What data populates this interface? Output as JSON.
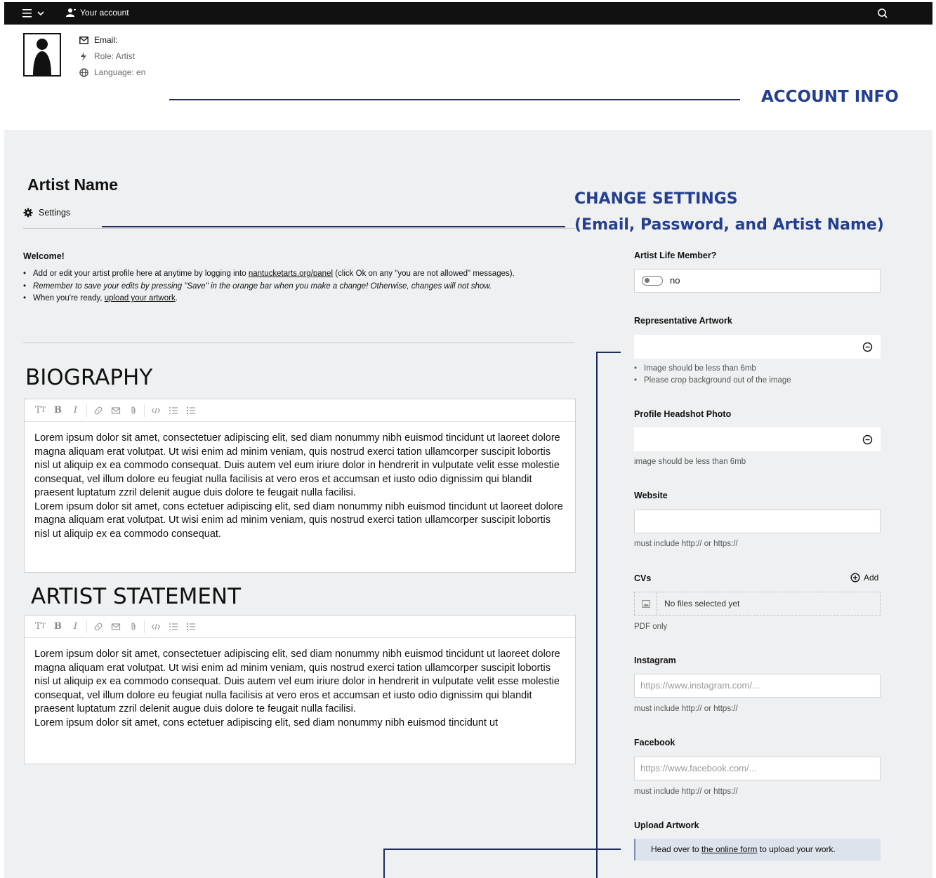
{
  "topbar": {
    "account_label": "Your account"
  },
  "account": {
    "email_label": "Email:",
    "role_label": "Role: Artist",
    "language_label": "Language: en"
  },
  "callouts": {
    "account_info": "ACCOUNT INFO",
    "change_settings_1": "CHANGE SETTINGS",
    "change_settings_2": "(Email, Password, and Artist Name)"
  },
  "profile": {
    "name": "Artist Name",
    "settings_tab": "Settings"
  },
  "welcome": {
    "heading": "Welcome!",
    "line1_pre": "Add or edit your artist profile here at anytime by logging into ",
    "line1_link": "nantucketarts.org/panel",
    "line1_post": " (click Ok on any \"you are not allowed\" messages).",
    "line2": "Remember to save your edits by pressing \"Save\" in the orange bar when you make a change! Otherwise, changes will not show.",
    "line3_pre": "When you're ready, ",
    "line3_link": "upload your artwork",
    "line3_post": "."
  },
  "biography": {
    "heading": "BIOGRAPHY",
    "p1": "Lorem ipsum dolor sit amet, consectetuer adipiscing elit, sed diam nonummy nibh euismod tincidunt ut laoreet dolore magna aliquam erat volutpat. Ut wisi enim ad minim veniam, quis nostrud exerci tation ullamcorper suscipit lobortis nisl ut aliquip ex ea commodo consequat. Duis autem vel eum iriure dolor in hendrerit in vulputate velit esse molestie consequat, vel illum dolore eu feugiat nulla facilisis at vero eros et accumsan et iusto odio dignissim qui blandit praesent luptatum zzril delenit augue duis dolore te feugait nulla facilisi.",
    "p2": "Lorem ipsum dolor sit amet, cons ectetuer adipiscing elit, sed diam nonummy nibh euismod tincidunt ut laoreet dolore magna aliquam erat volutpat. Ut wisi enim ad minim veniam, quis nostrud exerci tation ullamcorper suscipit lobortis nisl ut aliquip ex ea commodo consequat."
  },
  "statement": {
    "heading": "ARTIST STATEMENT",
    "p1": "Lorem ipsum dolor sit amet, consectetuer adipiscing elit, sed diam nonummy nibh euismod tincidunt ut laoreet dolore magna aliquam erat volutpat. Ut wisi enim ad minim veniam, quis nostrud exerci tation ullamcorper suscipit lobortis nisl ut aliquip ex ea commodo consequat. Duis autem vel eum iriure dolor in hendrerit in vulputate velit esse molestie consequat, vel illum dolore eu feugiat nulla facilisis at vero eros et accumsan et iusto odio dignissim qui blandit praesent luptatum zzril delenit augue duis dolore te feugait nulla facilisi.",
    "p2": "Lorem ipsum dolor sit amet, cons ectetuer adipiscing elit, sed diam nonummy nibh euismod tincidunt ut"
  },
  "fields": {
    "life_member_label": "Artist Life Member?",
    "life_member_value": "no",
    "rep_artwork_label": "Representative Artwork",
    "rep_artwork_help1": "Image should be less than 6mb",
    "rep_artwork_help2": "Please crop background out of the image",
    "headshot_label": "Profile Headshot Photo",
    "headshot_help": "image should be less than 6mb",
    "website_label": "Website",
    "website_help": "must include http:// or https://",
    "cvs_label": "CVs",
    "cvs_add": "Add",
    "cvs_empty": "No files selected yet",
    "cvs_help": "PDF only",
    "instagram_label": "Instagram",
    "instagram_placeholder": "https://www.instagram.com/...",
    "instagram_help": "must include http:// or https://",
    "facebook_label": "Facebook",
    "facebook_placeholder": "https://www.facebook.com/...",
    "facebook_help": "must include http:// or https://",
    "upload_label": "Upload Artwork",
    "upload_pre": "Head over to ",
    "upload_link": "the online form",
    "upload_post": " to upload your work."
  },
  "colors": {
    "callout": "#243f8f",
    "rule": "#1e2b5e",
    "panel_bg": "#eff0f1",
    "topbar_bg": "#111111"
  }
}
